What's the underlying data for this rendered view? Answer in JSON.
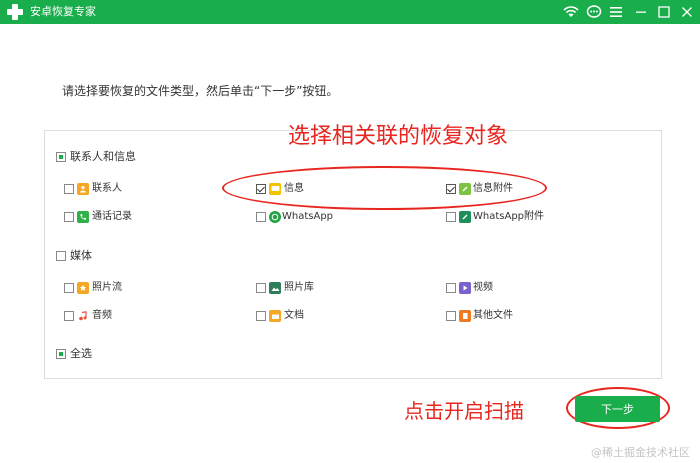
{
  "window": {
    "title": "安卓恢复专家",
    "icons": [
      "wifi-icon",
      "chat-icon",
      "menu-icon",
      "minimize-icon",
      "maximize-icon",
      "close-icon"
    ]
  },
  "instruction": "请选择要恢复的文件类型，然后单击“下一步”按钮。",
  "groups": {
    "contacts": {
      "label": "联系人和信息",
      "state": "partial",
      "items": {
        "contacts": {
          "label": "联系人",
          "checked": false,
          "icon": "contact-card-icon",
          "color": "#f5a623"
        },
        "messages": {
          "label": "信息",
          "checked": true,
          "icon": "message-icon",
          "color": "#f2c200"
        },
        "attachments": {
          "label": "信息附件",
          "checked": true,
          "icon": "paperclip-icon",
          "color": "#7dc242"
        },
        "call_log": {
          "label": "通话记录",
          "checked": false,
          "icon": "phone-icon",
          "color": "#2fb14a"
        },
        "whatsapp": {
          "label": "WhatsApp",
          "checked": false,
          "icon": "whatsapp-icon",
          "color": "#25a244"
        },
        "whatsapp_attachments": {
          "label": "WhatsApp附件",
          "checked": false,
          "icon": "whatsapp-attachment-icon",
          "color": "#1e8e5a"
        }
      }
    },
    "media": {
      "label": "媒体",
      "state": "unchecked",
      "items": {
        "photo_stream": {
          "label": "照片流",
          "checked": false,
          "icon": "photo-stream-icon",
          "color": "#f5a623"
        },
        "photo_library": {
          "label": "照片库",
          "checked": false,
          "icon": "photo-library-icon",
          "color": "#2e7d5b"
        },
        "video": {
          "label": "视频",
          "checked": false,
          "icon": "video-icon",
          "color": "#7b61c9"
        },
        "audio": {
          "label": "音频",
          "checked": false,
          "icon": "music-icon",
          "color": "#e8503a"
        },
        "documents": {
          "label": "文档",
          "checked": false,
          "icon": "folder-icon",
          "color": "#f5a623"
        },
        "other_files": {
          "label": "其他文件",
          "checked": false,
          "icon": "file-icon",
          "color": "#f07b22"
        }
      }
    },
    "select_all": {
      "label": "全选",
      "state": "partial"
    }
  },
  "annotations": {
    "top": "选择相关联的恢复对象",
    "bottom": "点击开启扫描"
  },
  "next_button": "下一步",
  "watermark": "@稀土掘金技术社区",
  "colors": {
    "brand": "#1aad4b",
    "annotation": "#e8261f"
  }
}
